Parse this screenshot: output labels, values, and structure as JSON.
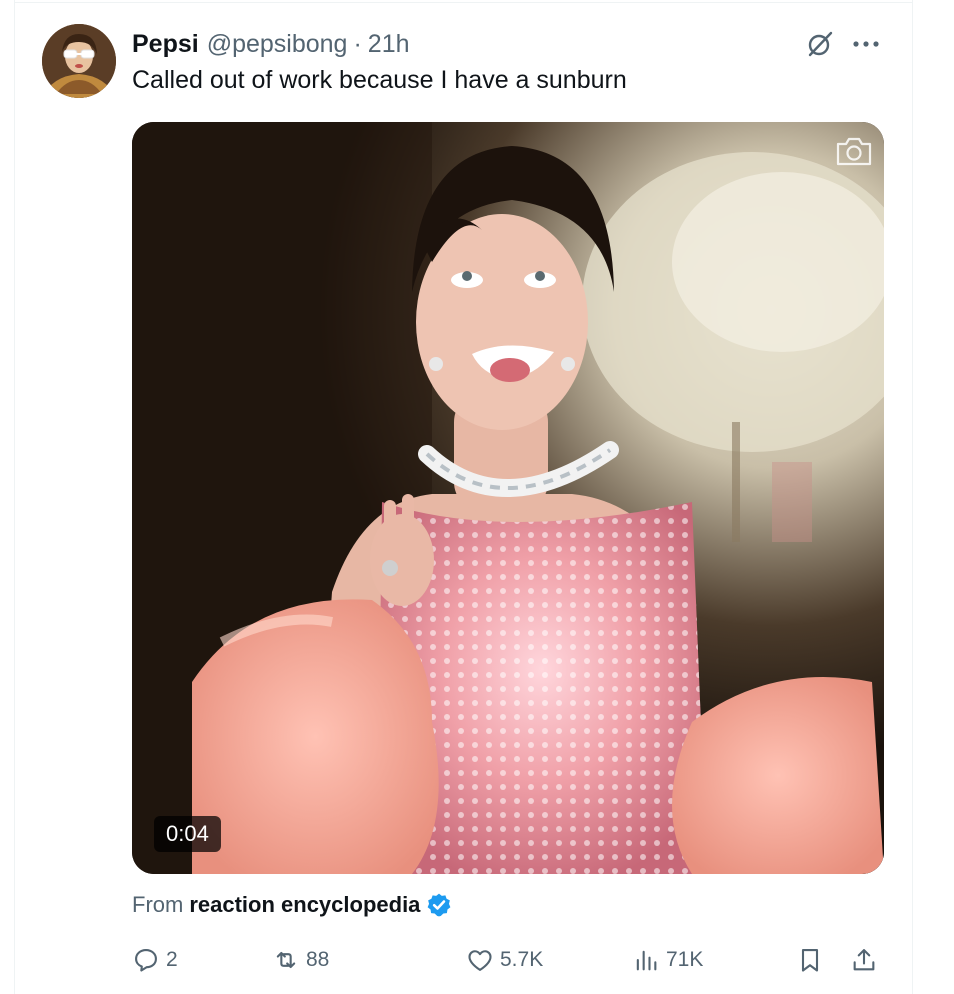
{
  "tweet": {
    "display_name": "Pepsi",
    "handle": "@pepsibong",
    "separator": "·",
    "time": "21h",
    "text": "Called out of work because I have a sunburn",
    "media": {
      "kind": "video",
      "duration": "0:04",
      "icons": [
        "camera-icon"
      ]
    },
    "source": {
      "prefix": "From",
      "name": "reaction encyclopedia",
      "verified": true
    },
    "icons": {
      "top_right": [
        "grok-icon",
        "more-icon"
      ],
      "actions": [
        "reply-icon",
        "retweet-icon",
        "like-icon",
        "views-icon",
        "bookmark-icon",
        "share-icon"
      ]
    },
    "stats": {
      "replies": "2",
      "retweets": "88",
      "likes": "5.7K",
      "views": "71K"
    }
  },
  "colors": {
    "text_primary": "#0f1419",
    "text_secondary": "#536471",
    "verified_blue": "#1d9bf0",
    "border": "#eff3f4"
  }
}
